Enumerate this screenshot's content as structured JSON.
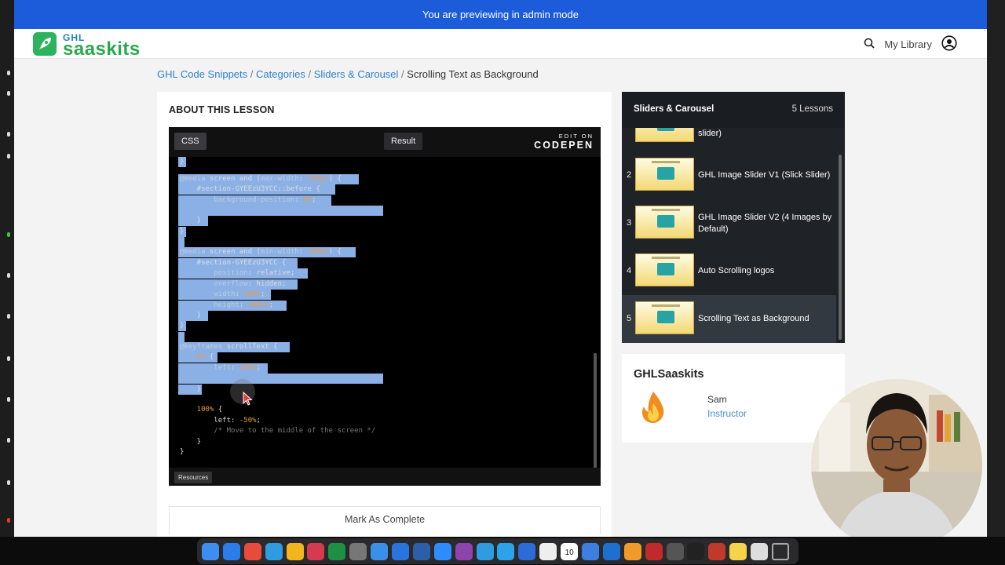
{
  "banner": {
    "text": "You are previewing in admin mode"
  },
  "header": {
    "logo_small": "GHL",
    "logo_big": "saaskits",
    "library_label": "My Library"
  },
  "breadcrumb": {
    "items": [
      "GHL Code Snippets",
      "Categories",
      "Sliders & Carousel"
    ],
    "current": "Scrolling Text as Background",
    "separator": "/"
  },
  "lesson": {
    "heading": "ABOUT THIS LESSON",
    "mark_complete": "Mark As Complete"
  },
  "codepen": {
    "tab_css": "CSS",
    "tab_result": "Result",
    "brand_top": "EDIT ON",
    "brand_name": "CODEPEN",
    "resources": "Resources",
    "code": {
      "l01": "}",
      "l02_a": "@media",
      "l02_b": " screen and (",
      "l02_c": "max-width",
      "l02_d": ": ",
      "l02_e": "768px",
      "l02_f": ") {",
      "l03": "    #section-GYEEzU3YCC::before {",
      "l04_a": "        background-position",
      "l04_b": ": ",
      "l04_c": "0%",
      "l04_d": ";",
      "l05": "    }",
      "l06": "}",
      "l07_a": "@media",
      "l07_b": " screen and (",
      "l07_c": "min-width",
      "l07_d": ": ",
      "l07_e": "769px",
      "l07_f": ") {",
      "l08": "    #section-GYEEzU3YCC {",
      "l09_a": "        position",
      "l09_b": ": relative;",
      "l10_a": "        overflow",
      "l10_b": ": hidden;",
      "l11_a": "        width",
      "l11_b": ": ",
      "l11_c": "100%",
      "l11_d": ";",
      "l12_a": "        height",
      "l12_b": ": ",
      "l12_c": "100vh",
      "l12_d": ";",
      "l13": "    }",
      "l14": "}",
      "l15_a": "@keyframes",
      "l15_b": " scrollText {",
      "l16_a": "    0%",
      "l16_b": " {",
      "l17_a": "        left",
      "l17_b": ": ",
      "l17_c": "100%",
      "l17_d": ";",
      "l18": "    }",
      "l19_a": "    100%",
      "l19_b": " {",
      "l20_a": "        left: ",
      "l20_b": "-50%",
      "l20_c": ";",
      "l21": "        /* Move to the middle of the screen */",
      "l22": "    }",
      "l23": "}"
    }
  },
  "course": {
    "title": "Sliders & Carousel",
    "count": "5 Lessons",
    "items": [
      {
        "num": "",
        "label": "slider)"
      },
      {
        "num": "2",
        "label": "GHL Image Slider V1 (Slick Slider)"
      },
      {
        "num": "3",
        "label": "GHL Image Slider V2 (4 Images by Default)"
      },
      {
        "num": "4",
        "label": "Auto Scrolling logos"
      },
      {
        "num": "5",
        "label": "Scrolling Text as Background"
      }
    ]
  },
  "instructor": {
    "brand": "GHLSaaskits",
    "name": "Sam",
    "role": "Instructor"
  },
  "dock": {
    "apps": [
      "finder-icon",
      "app-store-icon",
      "launchpad-icon",
      "safari-icon",
      "chrome-icon",
      "slack-like-icon",
      "excel-like-icon",
      "settings-icon",
      "mail-icon",
      "xcode-icon",
      "photoshop-icon",
      "zoom-icon",
      "podcasts-icon",
      "chat-icon",
      "skype-icon",
      "finder-alt-icon",
      "notion-icon",
      "calendar-icon",
      "keynote-icon",
      "vscode-icon",
      "sublime-icon",
      "ruby-icon",
      "calculator-icon",
      "terminal-icon",
      "filezilla-icon",
      "notes-icon",
      "clock-icon",
      "trash-icon"
    ],
    "calendar_day": "10"
  },
  "colors": {
    "banner": "#1c5bd9",
    "link": "#2f7fd1",
    "selection": "#8ab0e6",
    "accent_green": "#29a84f"
  }
}
